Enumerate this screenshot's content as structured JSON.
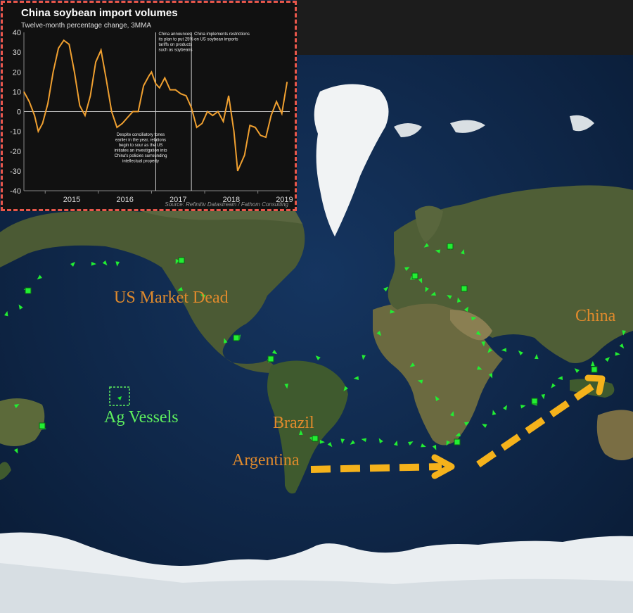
{
  "map": {
    "labels": {
      "us_market": "US Market Dead",
      "china": "China",
      "ag_vessels": "Ag Vessels",
      "brazil": "Brazil",
      "argentina": "Argentina"
    },
    "colors": {
      "ocean": "#0e2747",
      "land": "#4a5a32",
      "ice": "#eef2f4",
      "vessel": "#22ee33",
      "label_orange": "#e08a2c",
      "label_green": "#5ef05e",
      "route_arrow": "#f5b21b",
      "trend_arrow": "#23b7a0"
    }
  },
  "inset": {
    "title": "China soybean import volumes",
    "subtitle": "Twelve-month percentage change, 3MMA",
    "annotations": {
      "tariff": [
        "China announces",
        "its plan to put 25%",
        "tariffs on products",
        "such as soybeans"
      ],
      "restrictions": [
        "China implements restrictions",
        "on US soybean imports"
      ],
      "relations": [
        "Despite conciliatory tones",
        "earlier in the year, relations",
        "begin to sour as the US",
        "initiates an investigation into",
        "China's policies surrounding",
        "intellectual property"
      ]
    },
    "source": "Source: Refinitiv Datastream / Fathom Consulting",
    "border_color": "#e8574b",
    "line_color": "#f0a030"
  },
  "chart_data": {
    "type": "line",
    "title": "China soybean import volumes",
    "subtitle": "Twelve-month percentage change, 3MMA",
    "xlabel": "",
    "ylabel": "",
    "ylim": [
      -40,
      40
    ],
    "yticks": [
      40,
      30,
      20,
      10,
      0,
      -10,
      -20,
      -30,
      -40
    ],
    "xticks": [
      "2015",
      "2016",
      "2017",
      "2018",
      "2019"
    ],
    "xlim": [
      2014.6,
      2019.6
    ],
    "vlines": [
      2017.08,
      2017.75
    ],
    "series": [
      {
        "x": [
          2014.6,
          2014.7,
          2014.8,
          2014.87,
          2014.95,
          2015.05,
          2015.15,
          2015.25,
          2015.35,
          2015.45,
          2015.55,
          2015.65,
          2015.75,
          2015.85,
          2015.95,
          2016.05,
          2016.15,
          2016.25,
          2016.35,
          2016.45,
          2016.55,
          2016.65,
          2016.75,
          2016.85,
          2016.95,
          2017.0,
          2017.08,
          2017.15,
          2017.25,
          2017.35,
          2017.45,
          2017.55,
          2017.65,
          2017.75,
          2017.85,
          2017.95,
          2018.05,
          2018.15,
          2018.25,
          2018.35,
          2018.45,
          2018.55,
          2018.62,
          2018.75,
          2018.85,
          2018.95,
          2019.05,
          2019.15,
          2019.25,
          2019.35,
          2019.45,
          2019.55
        ],
        "y": [
          10,
          5,
          -2,
          -10,
          -6,
          4,
          20,
          32,
          36,
          34,
          20,
          3,
          -2,
          8,
          25,
          31,
          16,
          0,
          -8,
          -6,
          -3,
          0,
          0,
          13,
          18,
          20,
          14,
          12,
          17,
          11,
          11,
          9,
          8,
          2,
          -8,
          -6,
          0,
          -2,
          0,
          -5,
          8,
          -10,
          -30,
          -22,
          -7,
          -8,
          -12,
          -13,
          -2,
          5,
          -1,
          15
        ]
      }
    ]
  }
}
